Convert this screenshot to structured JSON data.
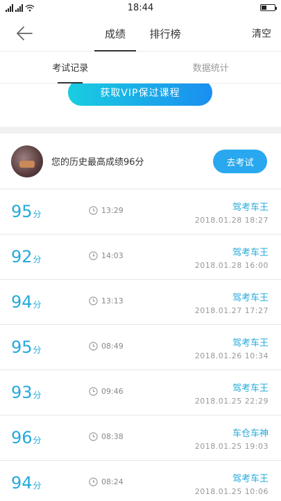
{
  "status_bar": {
    "time": "18:44"
  },
  "nav": {
    "tabs": [
      {
        "label": "成绩"
      },
      {
        "label": "排行榜"
      }
    ],
    "clear_label": "清空"
  },
  "sub_tabs": [
    {
      "label": "考试记录"
    },
    {
      "label": "数据统计"
    }
  ],
  "vip_button_label": "获取VIP保过课程",
  "best": {
    "text": "您的历史最高成绩96分",
    "button_label": "去考试"
  },
  "records": [
    {
      "score": "95",
      "unit": "分",
      "duration": "13:29",
      "title": "驾考车王",
      "date": "2018.01.28  18:27"
    },
    {
      "score": "92",
      "unit": "分",
      "duration": "14:03",
      "title": "驾考车王",
      "date": "2018.01.28  16:00"
    },
    {
      "score": "94",
      "unit": "分",
      "duration": "13:13",
      "title": "驾考车王",
      "date": "2018.01.27  17:27"
    },
    {
      "score": "95",
      "unit": "分",
      "duration": "08:49",
      "title": "驾考车王",
      "date": "2018.01.26  10:34"
    },
    {
      "score": "93",
      "unit": "分",
      "duration": "09:46",
      "title": "驾考车王",
      "date": "2018.01.25  22:29"
    },
    {
      "score": "96",
      "unit": "分",
      "duration": "08:38",
      "title": "车仓车神",
      "date": "2018.01.25  19:03"
    },
    {
      "score": "94",
      "unit": "分",
      "duration": "08:24",
      "title": "驾考车王",
      "date": "2018.01.25  10:06"
    }
  ]
}
